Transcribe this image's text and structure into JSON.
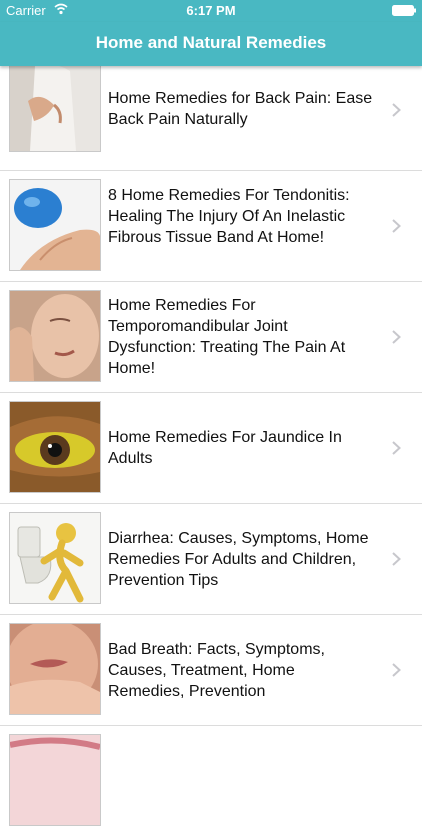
{
  "status_bar": {
    "carrier": "Carrier",
    "time": "6:17 PM",
    "wifi_icon": "wifi-icon",
    "battery_icon": "battery-icon"
  },
  "nav": {
    "title": "Home and Natural Remedies",
    "background": "#49b8c2"
  },
  "items": [
    {
      "title": "Home Remedies for Back Pain: Ease Back Pain Naturally",
      "thumb": "back-pain-photo"
    },
    {
      "title": "8 Home Remedies For Tendonitis: Healing The Injury Of An Inelastic Fibrous Tissue Band At Home!",
      "thumb": "ice-pack-hand-photo"
    },
    {
      "title": "Home Remedies For Temporomandibular Joint Dysfunction: Treating The Pain At Home!",
      "thumb": "jaw-pain-photo"
    },
    {
      "title": "Home Remedies For Jaundice In Adults",
      "thumb": "yellow-eye-photo"
    },
    {
      "title": "Diarrhea: Causes, Symptoms, Home Remedies For Adults and Children, Prevention Tips",
      "thumb": "toilet-figure-photo"
    },
    {
      "title": "Bad Breath: Facts, Symptoms, Causes, Treatment, Home Remedies, Prevention",
      "thumb": "bad-breath-photo"
    }
  ]
}
